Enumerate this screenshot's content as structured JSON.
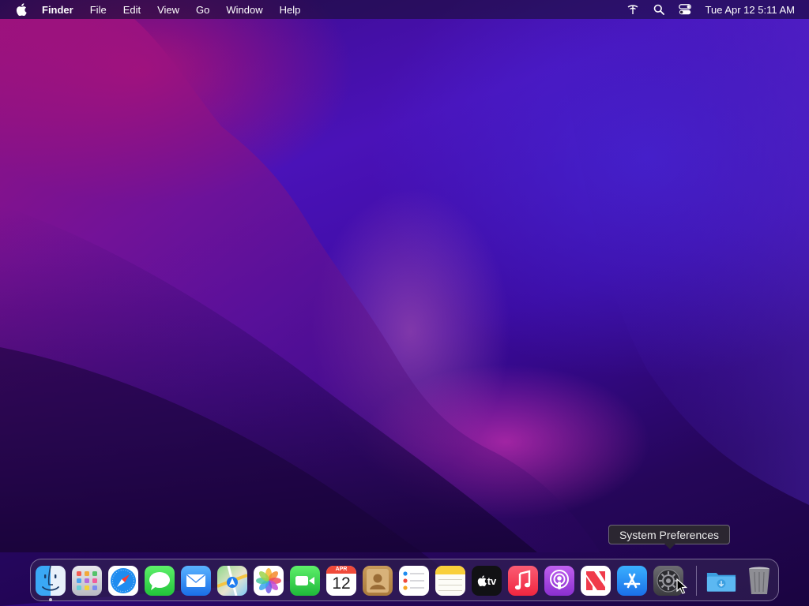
{
  "menubar": {
    "apple_icon": "apple-logo-icon",
    "app_name": "Finder",
    "items": [
      "File",
      "Edit",
      "View",
      "Go",
      "Window",
      "Help"
    ],
    "status_icons": [
      "wifi-icon",
      "search-icon",
      "control-center-icon"
    ],
    "clock": "Tue Apr 12  5:11 AM"
  },
  "tooltip": {
    "text": "System Preferences"
  },
  "dock": {
    "apps": [
      {
        "name": "Finder",
        "icon": "finder-icon",
        "running": true
      },
      {
        "name": "Launchpad",
        "icon": "launchpad-icon"
      },
      {
        "name": "Safari",
        "icon": "safari-icon"
      },
      {
        "name": "Messages",
        "icon": "messages-icon"
      },
      {
        "name": "Mail",
        "icon": "mail-icon"
      },
      {
        "name": "Maps",
        "icon": "maps-icon"
      },
      {
        "name": "Photos",
        "icon": "photos-icon"
      },
      {
        "name": "FaceTime",
        "icon": "facetime-icon"
      },
      {
        "name": "Calendar",
        "icon": "calendar-icon",
        "month": "APR",
        "day": "12"
      },
      {
        "name": "Contacts",
        "icon": "contacts-icon"
      },
      {
        "name": "Reminders",
        "icon": "reminders-icon"
      },
      {
        "name": "Notes",
        "icon": "notes-icon"
      },
      {
        "name": "TV",
        "icon": "apple-tv-icon",
        "label": "tv"
      },
      {
        "name": "Music",
        "icon": "music-icon"
      },
      {
        "name": "Podcasts",
        "icon": "podcasts-icon"
      },
      {
        "name": "News",
        "icon": "news-icon"
      },
      {
        "name": "App Store",
        "icon": "app-store-icon"
      },
      {
        "name": "System Preferences",
        "icon": "system-preferences-icon",
        "hovered": true
      }
    ],
    "right_items": [
      {
        "name": "Downloads",
        "icon": "downloads-folder-icon"
      },
      {
        "name": "Trash",
        "icon": "trash-icon"
      }
    ]
  },
  "colors": {
    "menubar_text": "#ffffff",
    "wallpaper_primary": "#3a0a86",
    "wallpaper_accent": "#c81470"
  }
}
